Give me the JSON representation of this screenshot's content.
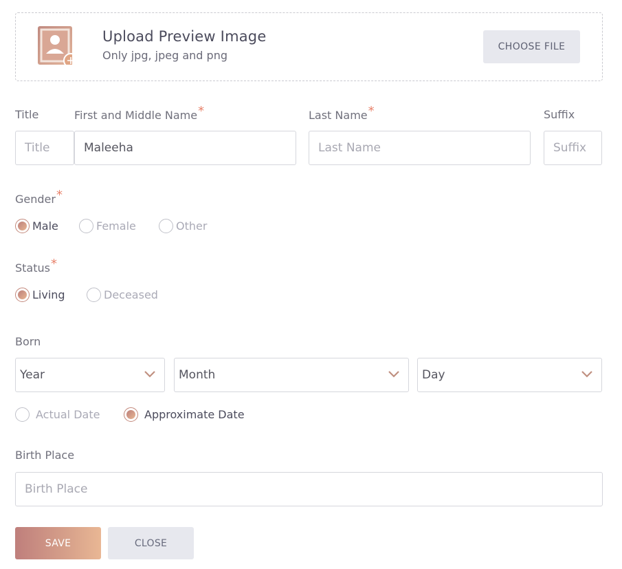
{
  "upload": {
    "title": "Upload Preview Image",
    "subtitle": "Only jpg, jpeg and png",
    "button_label": "CHOOSE FILE",
    "icon": "profile-photo-add-icon"
  },
  "name": {
    "title_label": "Title",
    "title_placeholder": "Title",
    "first_label": "First and Middle Name",
    "first_value": "Maleeha",
    "last_label": "Last Name",
    "last_placeholder": "Last Name",
    "suffix_label": "Suffix",
    "suffix_placeholder": "Suffix",
    "required_mark": "*"
  },
  "gender": {
    "label": "Gender",
    "options": [
      "Male",
      "Female",
      "Other"
    ],
    "selected": "Male"
  },
  "status": {
    "label": "Status",
    "options": [
      "Living",
      "Deceased"
    ],
    "selected": "Living"
  },
  "born": {
    "label": "Born",
    "year": "Year",
    "month": "Month",
    "day": "Day",
    "date_options": [
      "Actual Date",
      "Approximate Date"
    ],
    "date_selected": "Approximate Date"
  },
  "birth_place": {
    "label": "Birth Place",
    "placeholder": "Birth Place"
  },
  "actions": {
    "save": "SAVE",
    "close": "CLOSE"
  },
  "colors": {
    "accent_start": "#bc7f7b",
    "accent_end": "#e9b794",
    "required": "#e8826b",
    "secondary_button": "#e7e8ee"
  }
}
